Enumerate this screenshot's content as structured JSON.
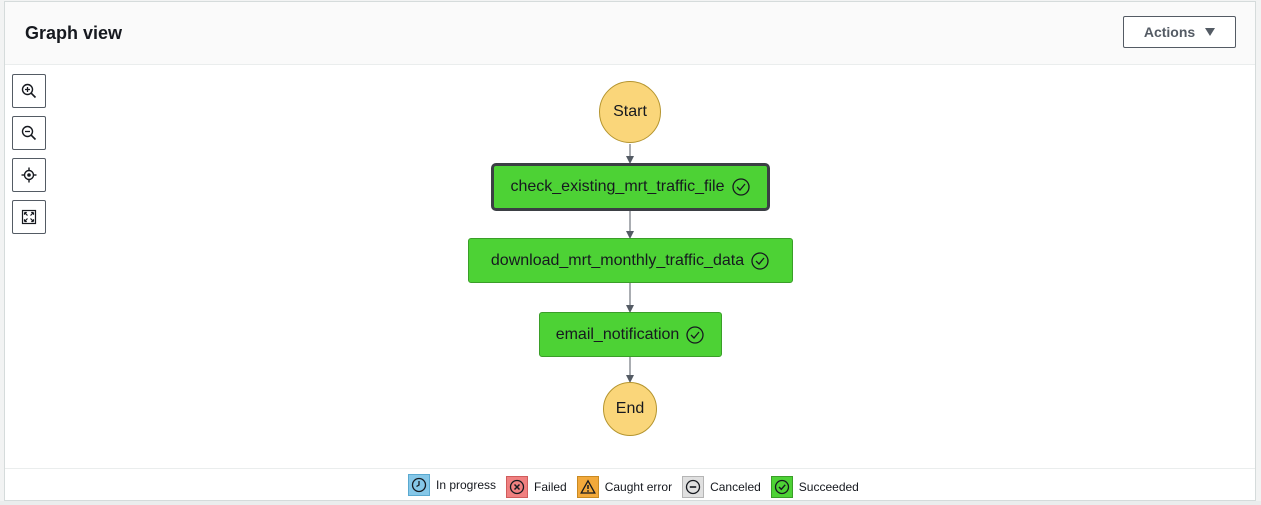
{
  "panel": {
    "title": "Graph view",
    "actions_label": "Actions"
  },
  "zoom_controls": [
    {
      "name": "zoom-in",
      "icon": "zoom-in-icon"
    },
    {
      "name": "zoom-out",
      "icon": "zoom-out-icon"
    },
    {
      "name": "center",
      "icon": "center-icon"
    },
    {
      "name": "fit",
      "icon": "fit-to-screen-icon"
    }
  ],
  "graph": {
    "start_label": "Start",
    "end_label": "End",
    "states": [
      {
        "label": "check_existing_mrt_traffic_file",
        "status": "Succeeded",
        "selected": true
      },
      {
        "label": "download_mrt_monthly_traffic_data",
        "status": "Succeeded",
        "selected": false
      },
      {
        "label": "email_notification",
        "status": "Succeeded",
        "selected": false
      }
    ]
  },
  "legend": {
    "items": [
      {
        "label": "In progress",
        "icon": "clock-icon",
        "color": "#85c7e8"
      },
      {
        "label": "Failed",
        "icon": "x-circle-icon",
        "color": "#f08080"
      },
      {
        "label": "Caught error",
        "icon": "warning-icon",
        "color": "#f2a93b"
      },
      {
        "label": "Canceled",
        "icon": "minus-circle-icon",
        "color": "#e0e0e0"
      },
      {
        "label": "Succeeded",
        "icon": "check-circle-icon",
        "color": "#4dd235"
      }
    ]
  },
  "colors": {
    "succeeded": "#4dd235",
    "terminal": "#fad67a"
  }
}
